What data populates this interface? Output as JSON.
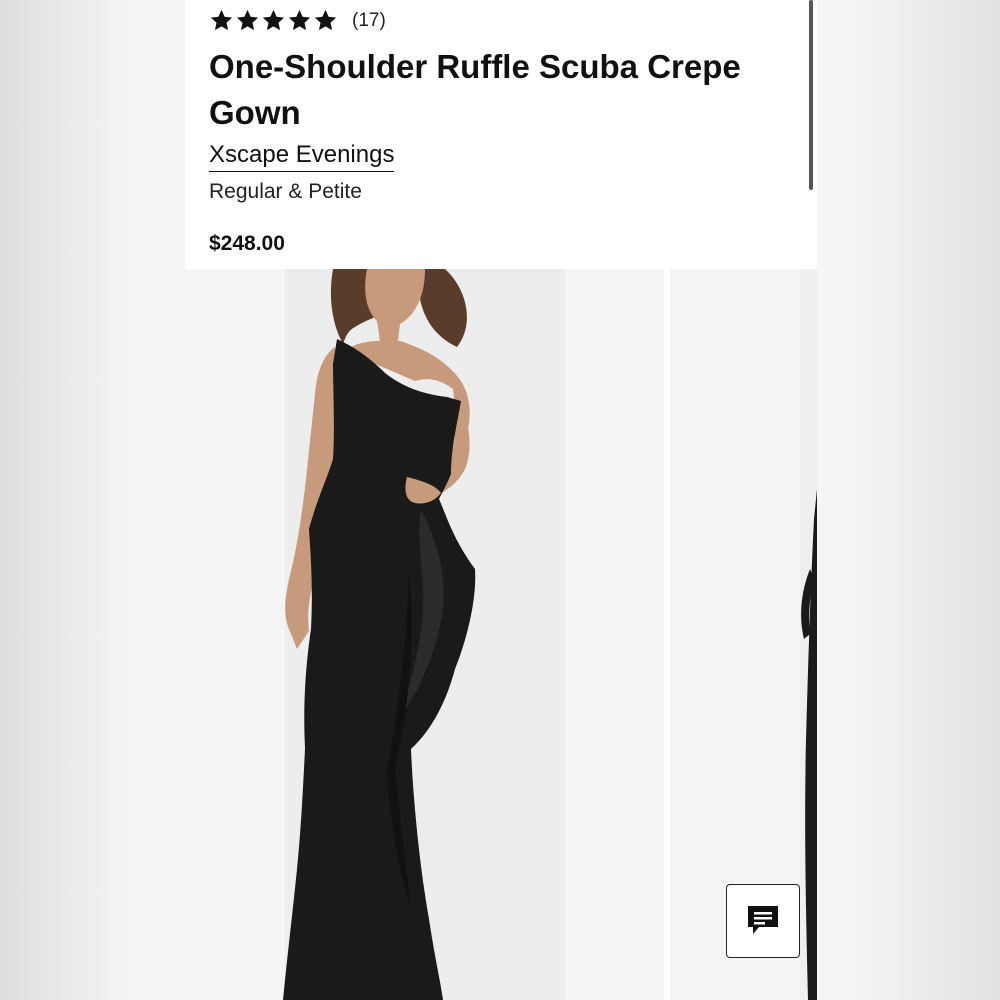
{
  "product": {
    "rating": 5,
    "review_count": "(17)",
    "title": "One-Shoulder Ruffle Scuba Crepe Gown",
    "brand": "Xscape Evenings",
    "fit": "Regular & Petite",
    "price": "$248.00"
  },
  "gallery": {
    "images": [
      {
        "alt": "model wearing black one-shoulder ruffle gown"
      },
      {
        "alt": "next product image"
      }
    ]
  },
  "icons": {
    "star": "star-icon",
    "chat": "chat-icon"
  },
  "colors": {
    "text": "#111111",
    "dress": "#1a1a1a",
    "background": "#ffffff"
  }
}
